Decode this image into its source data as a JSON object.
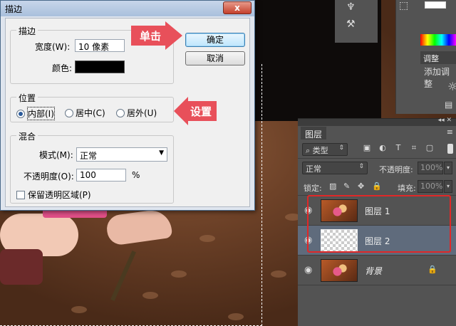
{
  "dialog": {
    "title": "描边",
    "close_label": "x",
    "stroke_group": {
      "title": "描边",
      "width_label": "宽度(W):",
      "width_value": "10 像素",
      "color_label": "颜色:"
    },
    "position_group": {
      "title": "位置",
      "options": [
        {
          "label": "内部(I)",
          "selected": true
        },
        {
          "label": "居中(C)",
          "selected": false
        },
        {
          "label": "居外(U)",
          "selected": false
        }
      ]
    },
    "blend_group": {
      "title": "混合",
      "mode_label": "模式(M):",
      "mode_value": "正常",
      "opacity_label": "不透明度(O):",
      "opacity_value": "100",
      "opacity_unit": "%",
      "preserve_label": "保留透明区域(P)"
    },
    "ok_label": "确定",
    "cancel_label": "取消"
  },
  "annotations": {
    "click": "单击",
    "setup": "设置"
  },
  "annotation_color": "#e8505a",
  "highlight_color": "#e02828",
  "top_panel": {
    "adjust_tab": "调整",
    "adjust_add": "添加调整"
  },
  "layers_panel": {
    "tab_label": "图层",
    "menu_icon": "≡",
    "filter_type": "类型",
    "blend_mode": "正常",
    "opacity_label": "不透明度:",
    "opacity_value": "100%",
    "lock_label": "锁定:",
    "fill_label": "填充:",
    "fill_value": "100%",
    "layers": [
      {
        "name": "图层 1",
        "thumb": "photo",
        "selected": false,
        "italic": false,
        "locked": false
      },
      {
        "name": "图层 2",
        "thumb": "transparent",
        "selected": true,
        "italic": false,
        "locked": false
      },
      {
        "name": "背景",
        "thumb": "photo",
        "selected": false,
        "italic": true,
        "locked": true
      }
    ]
  }
}
